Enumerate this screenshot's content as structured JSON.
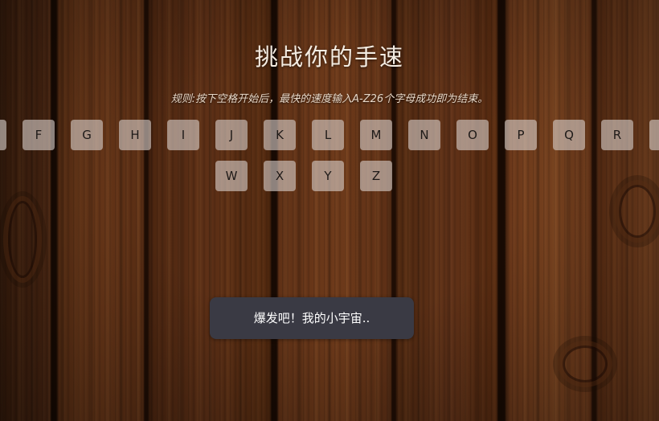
{
  "title": "挑战你的手速",
  "rule": "规则:按下空格开始后，最快的速度输入A-Z26个字母成功即为结束。",
  "keys_row1": [
    "",
    "F",
    "G",
    "H",
    "I",
    "J",
    "K",
    "L",
    "M",
    "N",
    "O",
    "P",
    "Q",
    "R",
    ""
  ],
  "keys_row2": [
    "W",
    "X",
    "Y",
    "Z"
  ],
  "start_button": "爆发吧！我的小宇宙.."
}
